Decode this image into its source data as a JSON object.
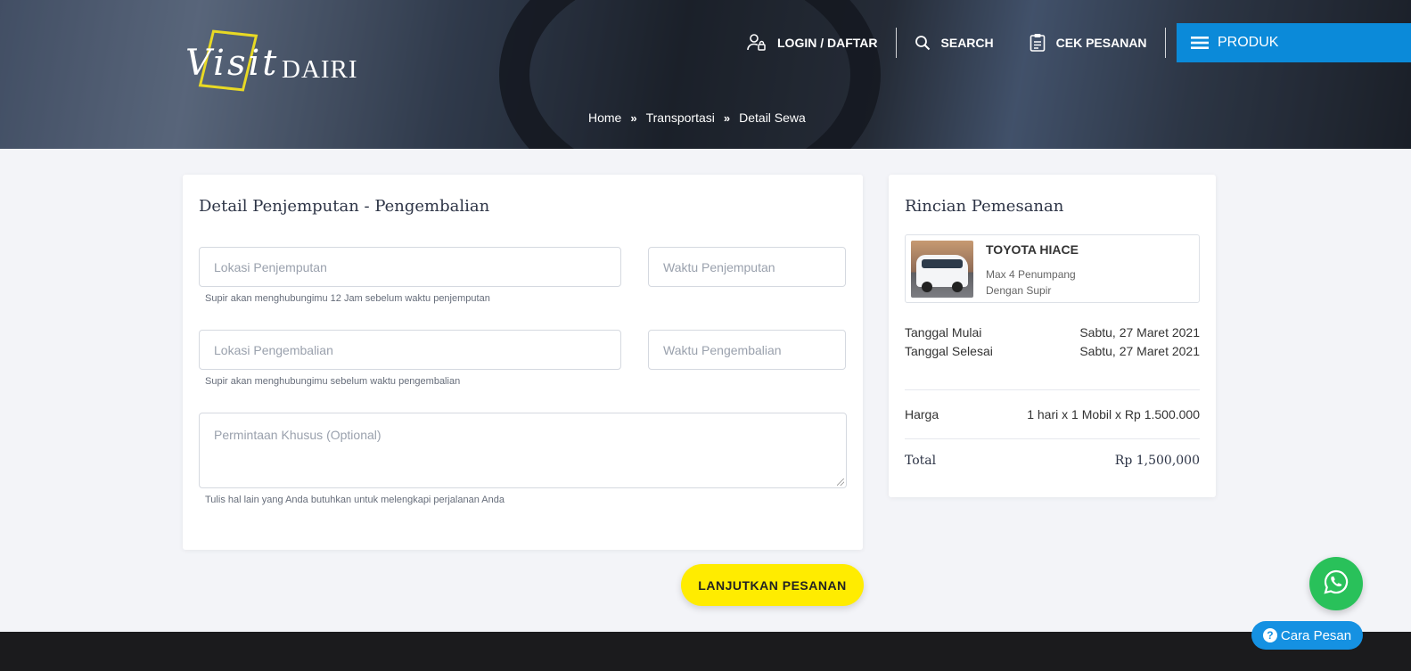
{
  "header": {
    "logo_script": "Visit",
    "logo_main": "DAIRI",
    "nav": {
      "login": "LOGIN / DAFTAR",
      "search": "SEARCH",
      "cek_pesanan": "CEK PESANAN",
      "produk": "PRODUK"
    },
    "breadcrumb": [
      "Home",
      "Transportasi",
      "Detail Sewa"
    ]
  },
  "form": {
    "title": "Detail Penjemputan - Pengembalian",
    "pickup_location_placeholder": "Lokasi Penjemputan",
    "pickup_time_placeholder": "Waktu Penjemputan",
    "pickup_hint": "Supir akan menghubungimu 12 Jam sebelum waktu penjemputan",
    "return_location_placeholder": "Lokasi Pengembalian",
    "return_time_placeholder": "Waktu Pengembalian",
    "return_hint": "Supir akan menghubungimu sebelum waktu pengembalian",
    "special_request_placeholder": "Permintaan Khusus (Optional)",
    "special_request_hint": "Tulis hal lain yang Anda butuhkan untuk melengkapi perjalanan Anda",
    "submit_label": "LANJUTKAN PESANAN"
  },
  "summary": {
    "title": "Rincian Pemesanan",
    "product_name": "TOYOTA HIACE",
    "capacity": "Max 4 Penumpang",
    "driver": "Dengan Supir",
    "start_label": "Tanggal Mulai",
    "start_value": "Sabtu, 27 Maret 2021",
    "end_label": "Tanggal Selesai",
    "end_value": "Sabtu, 27 Maret 2021",
    "price_label": "Harga",
    "price_value": "1 hari x 1 Mobil x Rp 1.500.000",
    "total_label": "Total",
    "total_value": "Rp 1,500,000"
  },
  "floating": {
    "cara_pesan": "Cara Pesan",
    "cara_icon": "?"
  },
  "colors": {
    "accent_blue": "#0b8ad9",
    "button_yellow": "#ffec00",
    "whatsapp_green": "#29c15a"
  }
}
